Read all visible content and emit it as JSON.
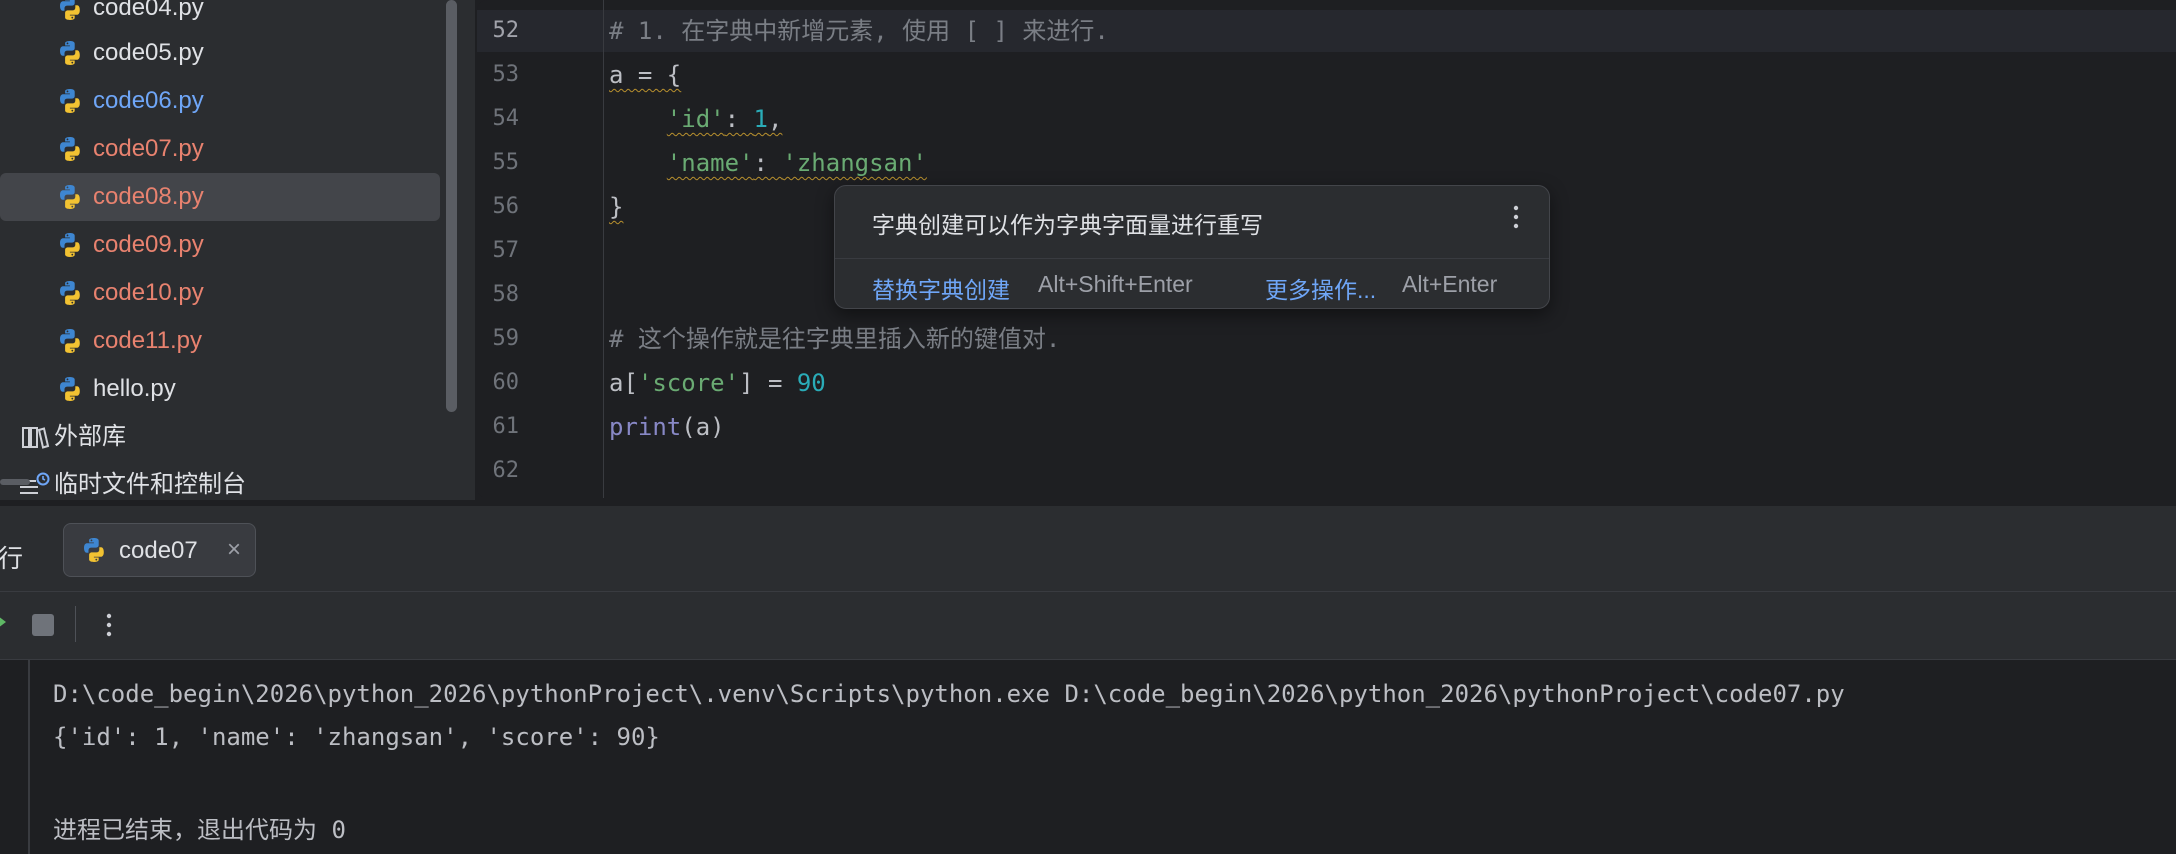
{
  "project_tree": {
    "files": [
      {
        "name": "code04.py",
        "status": "normal"
      },
      {
        "name": "code05.py",
        "status": "normal"
      },
      {
        "name": "code06.py",
        "status": "modified"
      },
      {
        "name": "code07.py",
        "status": "unversioned"
      },
      {
        "name": "code08.py",
        "status": "unversioned"
      },
      {
        "name": "code09.py",
        "status": "unversioned"
      },
      {
        "name": "code10.py",
        "status": "unversioned"
      },
      {
        "name": "code11.py",
        "status": "unversioned"
      },
      {
        "name": "hello.py",
        "status": "normal"
      }
    ],
    "selected_file": "code08.py",
    "external_libraries": "外部库",
    "scratches": "临时文件和控制台"
  },
  "editor": {
    "current_line": 52,
    "lines": [
      {
        "number": "52",
        "text": "# 1. 在字典中新增元素, 使用 [ ] 来进行."
      },
      {
        "number": "53",
        "text": "a = {"
      },
      {
        "number": "54",
        "text": "    'id': 1,"
      },
      {
        "number": "55",
        "text": "    'name': 'zhangsan'"
      },
      {
        "number": "56",
        "text": "}"
      },
      {
        "number": "57",
        "text": ""
      },
      {
        "number": "58",
        "text": ""
      },
      {
        "number": "59",
        "text": "# 这个操作就是往字典里插入新的键值对."
      },
      {
        "number": "60",
        "text": "a['score'] = 90"
      },
      {
        "number": "61",
        "text": "print(a)"
      },
      {
        "number": "62",
        "text": ""
      }
    ]
  },
  "intention_popup": {
    "title": "字典创建可以作为字典字面量进行重写",
    "action_primary": "替换字典创建",
    "action_primary_shortcut": "Alt+Shift+Enter",
    "action_more": "更多操作...",
    "action_more_shortcut": "Alt+Enter"
  },
  "run_panel": {
    "header_label": "行",
    "tab_label": "code07",
    "tab_close": "×",
    "console_lines": [
      "D:\\code_begin\\2026\\python_2026\\pythonProject\\.venv\\Scripts\\python.exe D:\\code_begin\\2026\\python_2026\\pythonProject\\code07.py",
      "{'id': 1, 'name': 'zhangsan', 'score': 90}",
      "",
      "进程已结束，退出代码为 0"
    ]
  },
  "colors": {
    "background": "#1e1f22",
    "panel": "#2b2d30",
    "modified_file": "#6fa6f7",
    "unversioned_file": "#e8826f",
    "comment": "#7a7e85",
    "string": "#6aab73",
    "number": "#2aacb8",
    "builtin": "#8888c6"
  },
  "icons": {
    "python_file": "python-file-icon",
    "library": "library-icon",
    "scratches": "scratches-icon",
    "more": "more-vertical-icon",
    "stop": "stop-icon",
    "rerun": "rerun-icon"
  }
}
